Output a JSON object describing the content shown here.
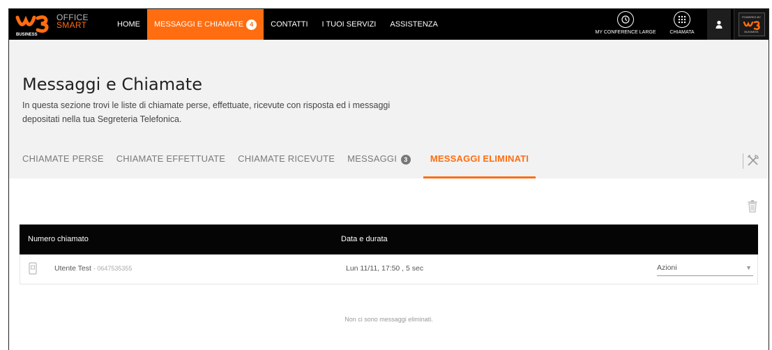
{
  "brand": {
    "logo_text": "BUSINESS",
    "product_line1": "OFFICE",
    "product_line2": "SMART",
    "accent_color": "#ff6d10"
  },
  "nav": {
    "items": [
      {
        "label": "HOME",
        "active": false
      },
      {
        "label": "MESSAGGI E CHIAMATE",
        "active": true,
        "badge": "4"
      },
      {
        "label": "CONTATTI",
        "active": false
      },
      {
        "label": "I TUOI SERVIZI",
        "active": false
      },
      {
        "label": "ASSISTENZA",
        "active": false
      }
    ]
  },
  "tools": {
    "conference_label": "MY CONFERENCE LARGE",
    "call_label": "CHIAMATA",
    "conference_icon": "conference-clock-icon",
    "call_icon": "keypad-icon",
    "user_icon": "user-icon",
    "partner_top": "POWERED BY",
    "partner_bottom": "BUSINESS"
  },
  "page": {
    "title": "Messaggi e Chiamate",
    "description": "In questa sezione trovi le liste di chiamate perse, effettuate, ricevute con risposta ed i messaggi depositati nella tua Segreteria Telefonica."
  },
  "tabs": [
    {
      "label": "CHIAMATE PERSE",
      "active": false
    },
    {
      "label": "CHIAMATE EFFETTUATE",
      "active": false
    },
    {
      "label": "CHIAMATE RICEVUTE",
      "active": false
    },
    {
      "label": "MESSAGGI",
      "active": false,
      "badge": "3"
    },
    {
      "label": "MESSAGGI ELIMINATI",
      "active": true
    }
  ],
  "table": {
    "columns": [
      "Numero chiamato",
      "Data e durata"
    ],
    "rows": [
      {
        "name": "Utente Test",
        "number": "0647535355",
        "date": "Lun 11/11, 17:50 , 5 sec",
        "actions_label": "Azioni"
      }
    ],
    "empty_text": "Non ci sono messaggi eliminati."
  }
}
